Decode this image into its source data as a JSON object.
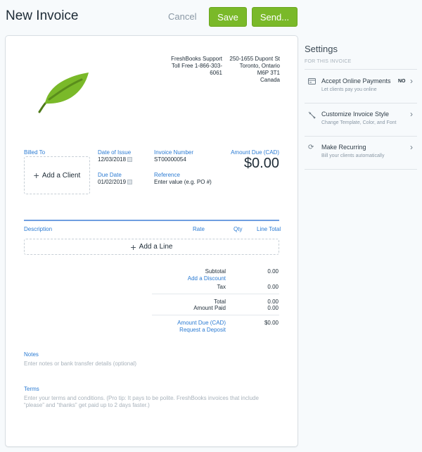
{
  "header": {
    "title": "New Invoice",
    "cancel_label": "Cancel",
    "save_label": "Save",
    "send_label": "Send..."
  },
  "colors": {
    "accent_green": "#7ab929",
    "link_blue": "#2b7bd3",
    "background": "#f7fafc"
  },
  "invoice": {
    "logo_icon": "leaf-icon",
    "company": {
      "name": "FreshBooks Support",
      "phone": "Toll Free 1-866-303-6061"
    },
    "address": {
      "line1": "250-1655 Dupont St",
      "line2": "Toronto, Ontario",
      "line3": "M6P 3T1",
      "line4": "Canada"
    },
    "billed_to": {
      "label": "Billed To",
      "add_client_label": "Add a Client"
    },
    "date_of_issue": {
      "label": "Date of Issue",
      "value": "12/03/2018"
    },
    "due_date": {
      "label": "Due Date",
      "value": "01/02/2019"
    },
    "invoice_number": {
      "label": "Invoice Number",
      "value": "ST00000054"
    },
    "reference": {
      "label": "Reference",
      "placeholder": "Enter value (e.g. PO #)"
    },
    "amount_due": {
      "label": "Amount Due (CAD)",
      "value": "$0.00"
    },
    "line_items": {
      "columns": [
        "Description",
        "Rate",
        "Qty",
        "Line Total"
      ],
      "add_line_label": "Add a Line"
    },
    "totals": {
      "subtotal_label": "Subtotal",
      "subtotal_value": "0.00",
      "discount_link": "Add a Discount",
      "tax_label": "Tax",
      "tax_value": "0.00",
      "total_label": "Total",
      "total_value": "0.00",
      "paid_label": "Amount Paid",
      "paid_value": "0.00",
      "due_label": "Amount Due (CAD)",
      "due_value": "$0.00",
      "deposit_link": "Request a Deposit"
    },
    "notes": {
      "label": "Notes",
      "placeholder": "Enter notes or bank transfer details (optional)"
    },
    "terms": {
      "label": "Terms",
      "placeholder": "Enter your terms and conditions. (Pro tip: It pays to be polite. FreshBooks invoices that include “please” and “thanks” get paid up to 2 days faster.)"
    }
  },
  "settings": {
    "title": "Settings",
    "subtitle": "FOR THIS INVOICE",
    "items": [
      {
        "icon": "credit-card-icon",
        "label": "Accept Online Payments",
        "description": "Let clients pay you online",
        "badge": "NO"
      },
      {
        "icon": "paintbrush-icon",
        "label": "Customize Invoice Style",
        "description": "Change Template, Color, and Font",
        "badge": ""
      },
      {
        "icon": "recurring-icon",
        "label": "Make Recurring",
        "description": "Bill your clients automatically",
        "badge": ""
      }
    ]
  }
}
